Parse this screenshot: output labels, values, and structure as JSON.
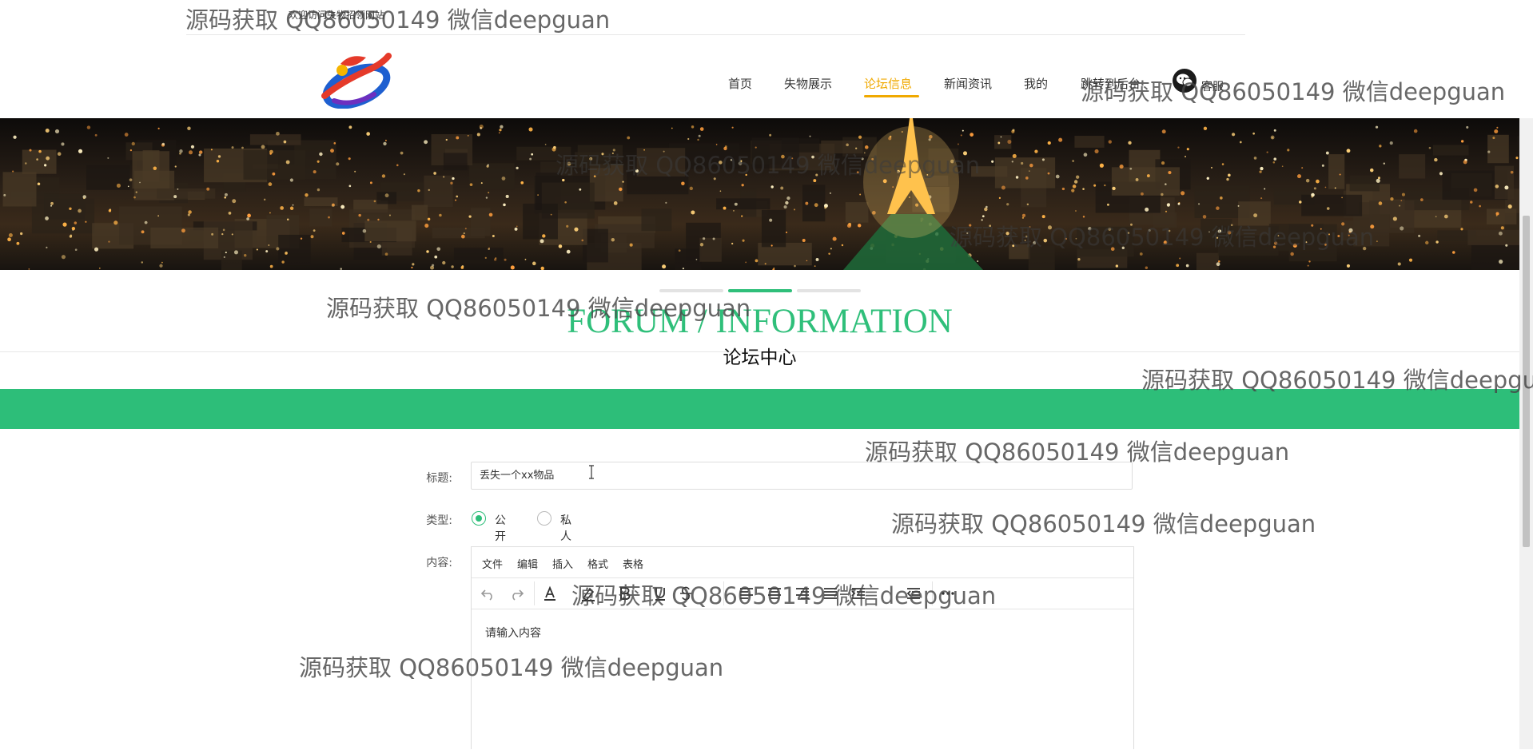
{
  "topbar": {
    "welcome": "欢迎访问失物招领网站"
  },
  "nav": {
    "items": [
      {
        "label": "首页"
      },
      {
        "label": "失物展示"
      },
      {
        "label": "论坛信息"
      },
      {
        "label": "新闻资讯"
      },
      {
        "label": "我的"
      },
      {
        "label": "跳转到后台"
      }
    ],
    "active_index": 2,
    "service_label": "客服",
    "active_color": "#f0a900"
  },
  "section": {
    "title_en": "FORUM / INFORMATION",
    "title_cn": "论坛中心",
    "accent_color": "#2dbe79"
  },
  "carousel": {
    "slides": 3,
    "active": 1
  },
  "form": {
    "title_label": "标题:",
    "title_value": "丢失一个xx物品",
    "type_label": "类型:",
    "type_options": [
      {
        "label": "公开",
        "checked": true
      },
      {
        "label": "私人",
        "checked": false
      }
    ],
    "content_label": "内容:"
  },
  "editor": {
    "menus": [
      "文件",
      "编辑",
      "插入",
      "格式",
      "表格"
    ],
    "toolbar_icons": [
      "undo-icon",
      "redo-icon",
      "text-color-icon",
      "highlight-icon",
      "bold-icon",
      "underline-icon",
      "strikethrough-icon",
      "align-left-icon",
      "align-center-icon",
      "align-right-icon",
      "align-justify-icon",
      "indent-icon",
      "outdent-icon",
      "more-icon"
    ],
    "placeholder": "请输入内容"
  },
  "watermarks": [
    "源码获取 QQ86050149 微信deepguan",
    "源码获取 QQ86050149 微信deepguan",
    "源码获取 QQ86050149 微信deepguan",
    "源码获取 QQ86050149 微信deepguan",
    "源码获取 QQ86050149 微信deepguan",
    "源码获取 QQ86050149 微信deepgu",
    "源码获取 QQ86050149 微信deepguan",
    "源码获取 QQ86050149 微信deepguan",
    "源码获取 QQ86050149 微信deepguan",
    "源码获取 QQ86050149 微信deepguan"
  ]
}
